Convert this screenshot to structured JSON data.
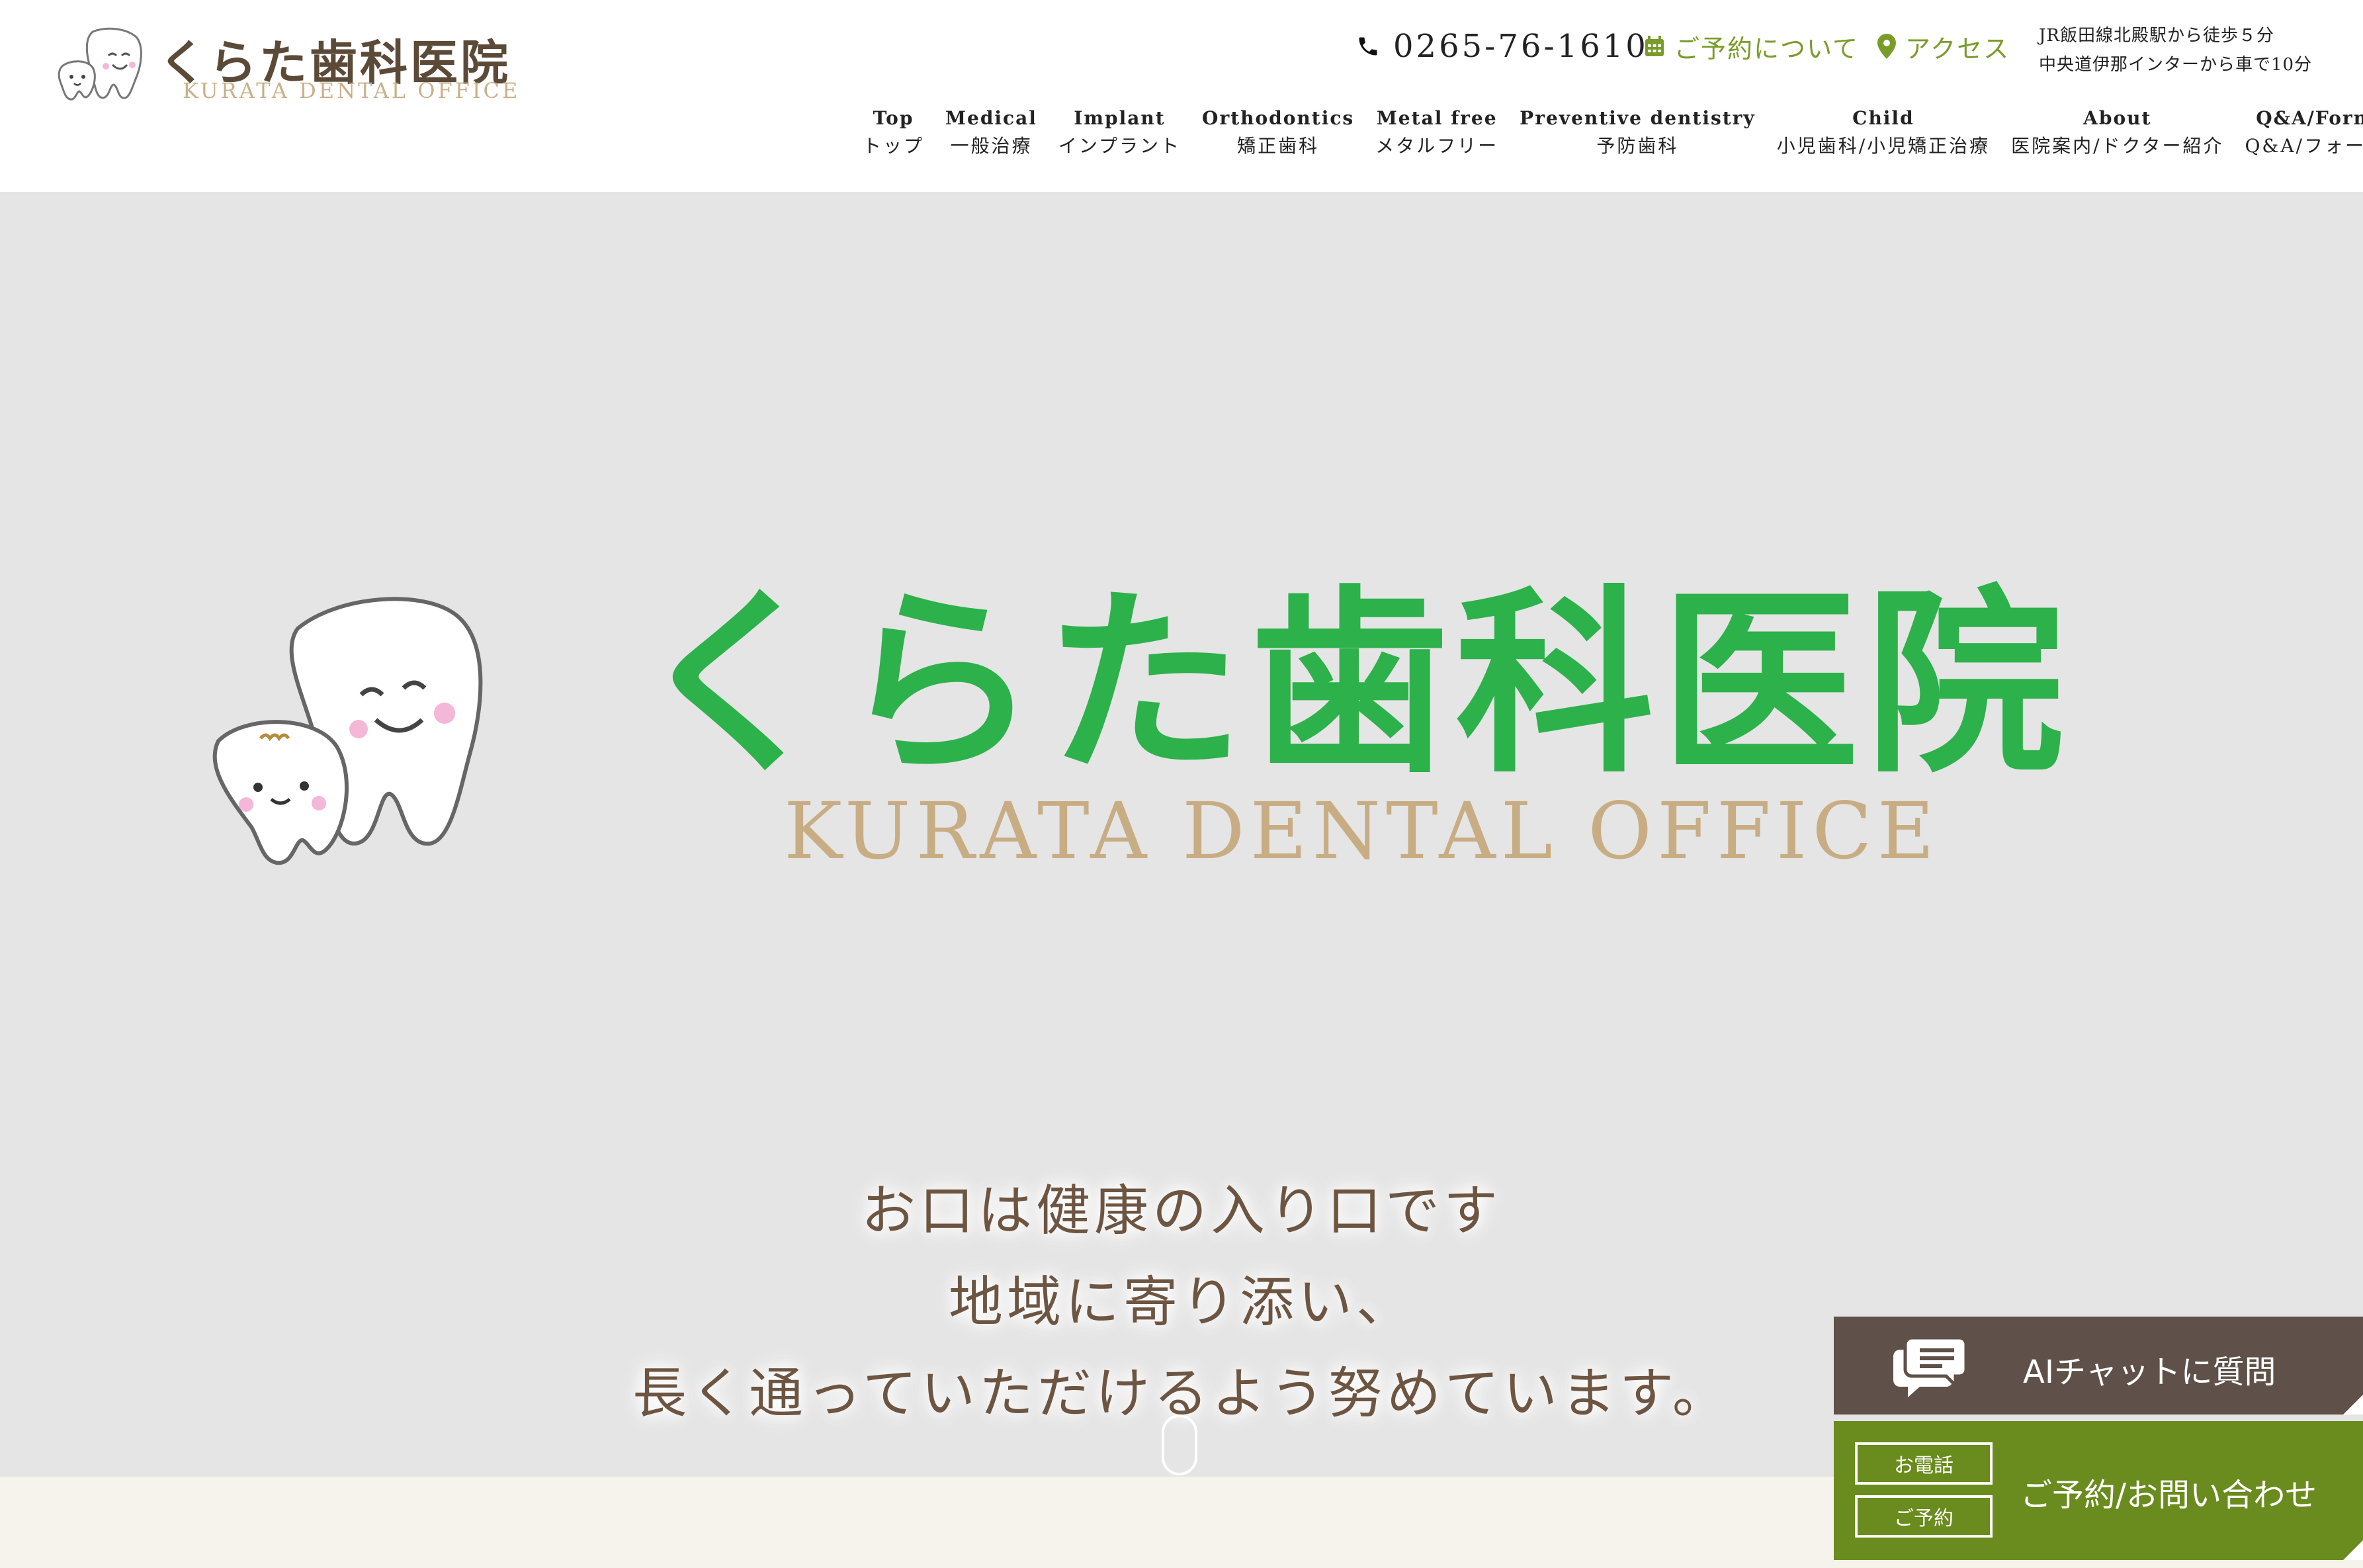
{
  "header": {
    "logo_title": "くらた歯科医院",
    "logo_sub": "KURATA DENTAL OFFICE",
    "phone": "0265-76-1610",
    "reserve_label": "ご予約について",
    "access_label": "アクセス",
    "route_line1": "JR飯田線北殿駅から徒歩５分",
    "route_line2": "中央道伊那インターから車で10分"
  },
  "nav": [
    {
      "en": "Top",
      "ja": "トップ"
    },
    {
      "en": "Medical",
      "ja": "一般治療"
    },
    {
      "en": "Implant",
      "ja": "インプラント"
    },
    {
      "en": "Orthodontics",
      "ja": "矯正歯科"
    },
    {
      "en": "Metal free",
      "ja": "メタルフリー"
    },
    {
      "en": "Preventive dentistry",
      "ja": "予防歯科"
    },
    {
      "en": "Child",
      "ja": "小児歯科/小児矯正治療"
    },
    {
      "en": "About",
      "ja": "医院案内/ドクター紹介"
    },
    {
      "en": "Q&A/Form",
      "ja": "Q&A/フォーム"
    }
  ],
  "hero": {
    "title": "くらた歯科医院",
    "subtitle": "KURATA DENTAL OFFICE",
    "copy_1": "お口は健康の入り口です",
    "copy_2": "地域に寄り添い、",
    "copy_3": "長く通っていただけるよう努めています。"
  },
  "widgets": {
    "ai_chat_label": "AIチャットに質問",
    "tel_button": "お電話",
    "reserve_button": "ご予約",
    "contact_label": "ご予約/お問い合わせ"
  },
  "colors": {
    "accent_green": "#7a9c2a",
    "logo_green": "#2db14a",
    "widget_brown": "#5f5149",
    "widget_green": "#6a8b1d"
  },
  "icons": [
    "phone-icon",
    "calendar-icon",
    "map-pin-icon",
    "chat-icon",
    "tooth-mascot-icon"
  ]
}
